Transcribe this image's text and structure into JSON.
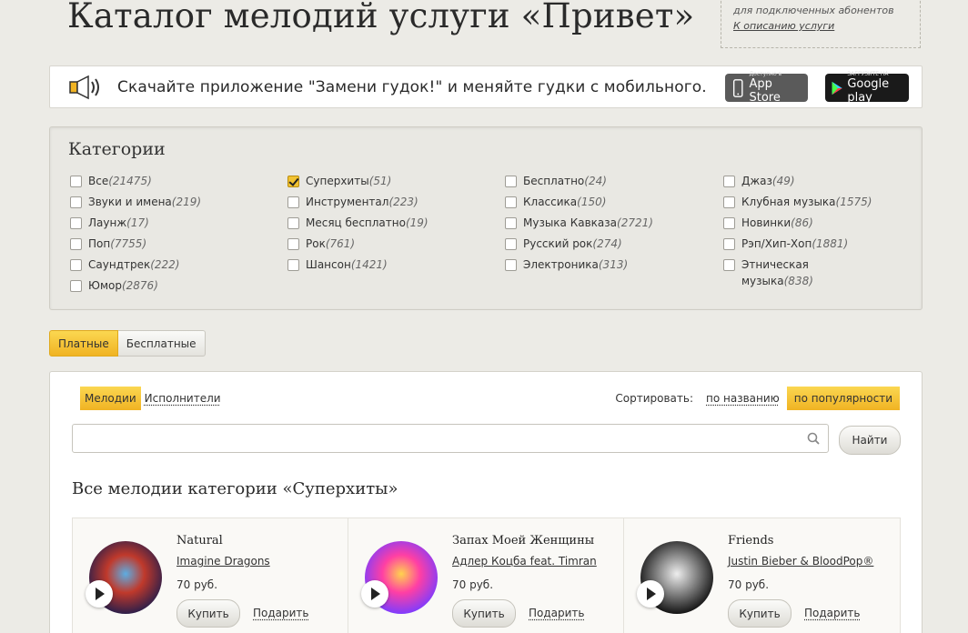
{
  "header": {
    "title": "Каталог мелодий услуги «Привет»",
    "subscriber_note": "для подключенных абонентов",
    "description_link": "К описанию услуги"
  },
  "banner": {
    "text": "Скачайте приложение \"Замени гудок!\" и меняйте гудки с мобильного.",
    "appstore_small": "Доступно в",
    "appstore_big": "App Store",
    "gplay_small": "ЗАГРУЗИТЕ НА",
    "gplay_big": "Google play",
    "icons": [
      "speaker-icon",
      "apple-icon",
      "google-play-icon"
    ]
  },
  "categories": {
    "title": "Категории",
    "columns": [
      [
        {
          "name": "Все",
          "count": "(21475)",
          "checked": false
        },
        {
          "name": "Звуки и имена",
          "count": "(219)",
          "checked": false
        },
        {
          "name": "Лаунж",
          "count": "(17)",
          "checked": false
        },
        {
          "name": "Поп",
          "count": "(7755)",
          "checked": false
        },
        {
          "name": "Саундтрек",
          "count": "(222)",
          "checked": false
        },
        {
          "name": "Юмор",
          "count": "(2876)",
          "checked": false
        }
      ],
      [
        {
          "name": "Суперхиты",
          "count": "(51)",
          "checked": true
        },
        {
          "name": "Инструментал",
          "count": "(223)",
          "checked": false
        },
        {
          "name": "Месяц бесплатно",
          "count": "(19)",
          "checked": false
        },
        {
          "name": "Рок",
          "count": "(761)",
          "checked": false
        },
        {
          "name": "Шансон",
          "count": "(1421)",
          "checked": false
        }
      ],
      [
        {
          "name": "Бесплатно",
          "count": "(24)",
          "checked": false
        },
        {
          "name": "Классика",
          "count": "(150)",
          "checked": false
        },
        {
          "name": "Музыка Кавказа",
          "count": "(2721)",
          "checked": false
        },
        {
          "name": "Русский рок",
          "count": "(274)",
          "checked": false
        },
        {
          "name": "Электроника",
          "count": "(313)",
          "checked": false
        }
      ],
      [
        {
          "name": "Джаз",
          "count": "(49)",
          "checked": false
        },
        {
          "name": "Клубная музыка",
          "count": "(1575)",
          "checked": false
        },
        {
          "name": "Новинки",
          "count": "(86)",
          "checked": false
        },
        {
          "name": "Рэп/Хип-Хоп",
          "count": "(1881)",
          "checked": false
        },
        {
          "name": "Этническая музыка",
          "count": "(838)",
          "checked": false
        }
      ]
    ]
  },
  "price_tabs": {
    "paid": "Платные",
    "free": "Бесплатные"
  },
  "main": {
    "tab_melodies": "Мелодии",
    "tab_artists": "Исполнители",
    "sort_label": "Сортировать:",
    "sort_by_name": "по названию",
    "sort_by_popularity": "по популярности",
    "search_value": "",
    "search_placeholder": "",
    "find_button": "Найти",
    "section_title": "Все мелодии категории «Суперхиты»"
  },
  "tracks": [
    {
      "title": "Natural",
      "artist": "Imagine Dragons",
      "price": "70 руб.",
      "buy": "Купить",
      "gift": "Подарить",
      "cover_colors": [
        "#2a1e4a",
        "#c0392b",
        "#5dade2"
      ]
    },
    {
      "title": "Запах Моей Женщины",
      "artist": "Адлер Коцба feat. Timran",
      "price": "70 руб.",
      "buy": "Купить",
      "gift": "Подарить",
      "cover_colors": [
        "#7d3cff",
        "#ff3fa4",
        "#ffd34d"
      ]
    },
    {
      "title": "Friends",
      "artist": "Justin Bieber & BloodPop®",
      "price": "70 руб.",
      "buy": "Купить",
      "gift": "Подарить",
      "cover_colors": [
        "#111111",
        "#888888",
        "#eeeeee"
      ]
    }
  ],
  "colors": {
    "accent_yellow": "#f7c63a",
    "background": "#ecebe6"
  }
}
